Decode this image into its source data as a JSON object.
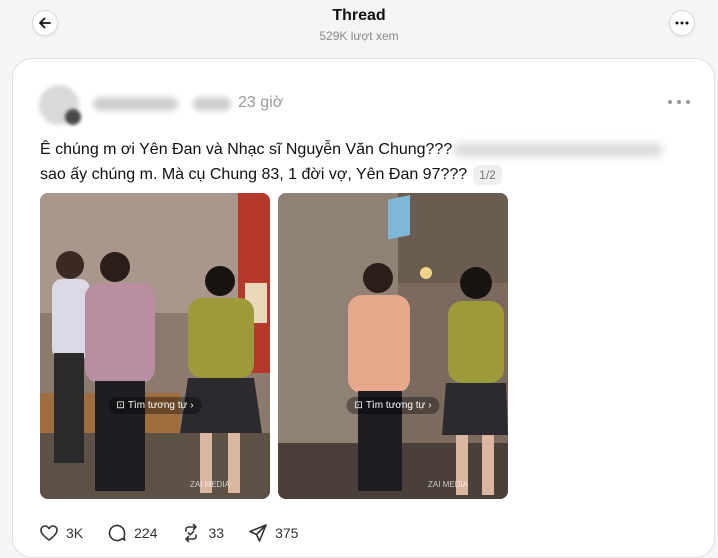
{
  "header": {
    "title": "Thread",
    "views": "529K lượt xem",
    "back_icon": "arrow-left-icon",
    "more_icon": "more-horizontal-icon"
  },
  "post": {
    "time": "23 giờ",
    "caption_line1": "Ê chúng m ơi Yên Đan và Nhạc sĩ Nguyễn Văn Chung???",
    "caption_line2": "sao ấy chúng m. Mà cụ Chung 83, 1 đời vợ, Yên Đan 97???",
    "page_indicator": "1/2",
    "media": [
      {
        "lens_label": "Tìm tương tự",
        "watermark": "ZAI MEDIA"
      },
      {
        "lens_label": "Tìm tương tự",
        "watermark": "ZAI MEDIA"
      }
    ],
    "actions": {
      "likes": "3K",
      "comments": "224",
      "reposts": "33",
      "shares": "375"
    }
  },
  "colors": {
    "background": "#f5f5f5",
    "card": "#ffffff",
    "text": "#101010",
    "muted": "#999999"
  }
}
